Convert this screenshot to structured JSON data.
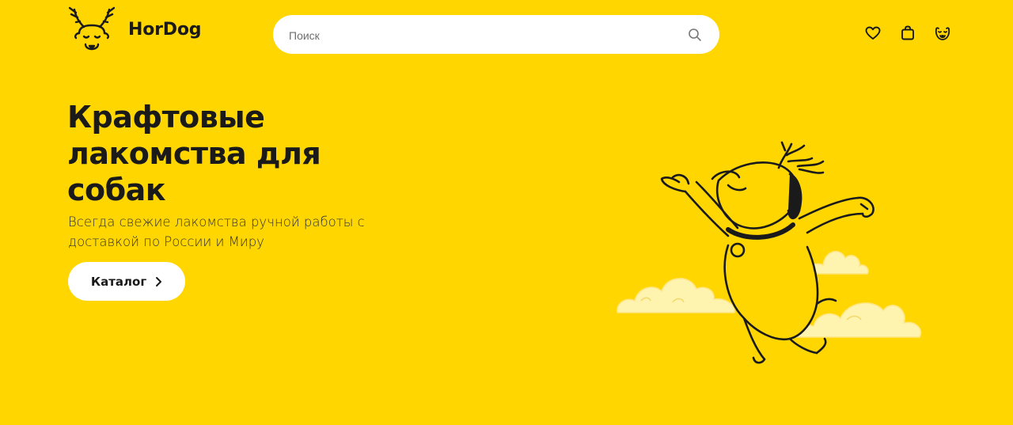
{
  "header": {
    "logo_text": "HorDog",
    "search_placeholder": "Поиск",
    "icons": [
      "deer-logo-icon",
      "search-icon",
      "heart-icon",
      "bag-icon",
      "dog-face-icon"
    ]
  },
  "hero": {
    "title": "Крафтовые лакомства для собак",
    "subtitle": "Всегда свежие лакомства ручной работы с доставкой по России и Миру",
    "button_label": "Каталог"
  },
  "colors": {
    "background": "#FFD600",
    "text": "#1a1a1a",
    "button": "#FFFFFF",
    "cloud": "#FFF3B0"
  }
}
